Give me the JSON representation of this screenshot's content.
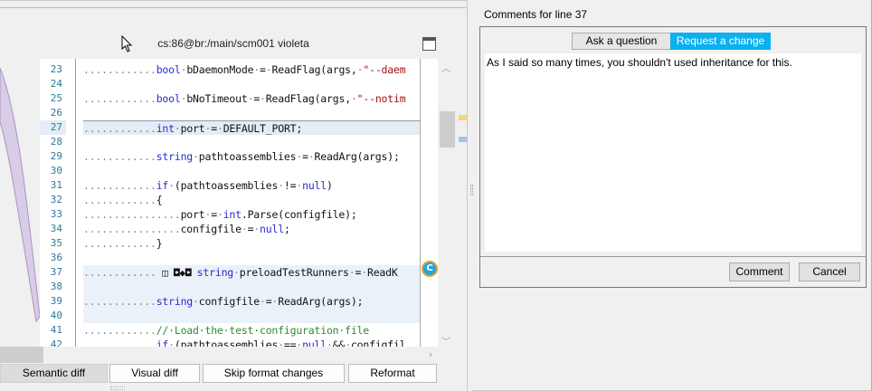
{
  "editor": {
    "file_title": "cs:86@br:/main/scm001 violeta",
    "highlighted_line": 27,
    "comment_line": 37,
    "comment_marker_letter": "C",
    "line_numbers": [
      23,
      24,
      25,
      26,
      27,
      28,
      29,
      30,
      31,
      32,
      33,
      34,
      35,
      36,
      37,
      38,
      39,
      40,
      41,
      42
    ],
    "lines": [
      [
        {
          "t": "............",
          "c": "d"
        },
        {
          "t": "bool",
          "c": "k"
        },
        {
          "t": "·",
          "c": "d"
        },
        {
          "t": "bDaemonMode",
          "c": "p"
        },
        {
          "t": "·",
          "c": "d"
        },
        {
          "t": "=",
          "c": "p"
        },
        {
          "t": "·",
          "c": "d"
        },
        {
          "t": "ReadFlag(args,",
          "c": "p"
        },
        {
          "t": "·",
          "c": "d"
        },
        {
          "t": "\"--daem",
          "c": "s"
        }
      ],
      [],
      [
        {
          "t": "............",
          "c": "d"
        },
        {
          "t": "bool",
          "c": "k"
        },
        {
          "t": "·",
          "c": "d"
        },
        {
          "t": "bNoTimeout",
          "c": "p"
        },
        {
          "t": "·",
          "c": "d"
        },
        {
          "t": "=",
          "c": "p"
        },
        {
          "t": "·",
          "c": "d"
        },
        {
          "t": "ReadFlag(args,",
          "c": "p"
        },
        {
          "t": "·",
          "c": "d"
        },
        {
          "t": "\"--notim",
          "c": "s"
        }
      ],
      [],
      [
        {
          "t": "............",
          "c": "d"
        },
        {
          "t": "int",
          "c": "k"
        },
        {
          "t": "·",
          "c": "d"
        },
        {
          "t": "port",
          "c": "p"
        },
        {
          "t": "·",
          "c": "d"
        },
        {
          "t": "=",
          "c": "p"
        },
        {
          "t": "·",
          "c": "d"
        },
        {
          "t": "DEFAULT_PORT;",
          "c": "p"
        }
      ],
      [],
      [
        {
          "t": "............",
          "c": "d"
        },
        {
          "t": "string",
          "c": "k"
        },
        {
          "t": "·",
          "c": "d"
        },
        {
          "t": "pathtoassemblies",
          "c": "p"
        },
        {
          "t": "·",
          "c": "d"
        },
        {
          "t": "=",
          "c": "p"
        },
        {
          "t": "·",
          "c": "d"
        },
        {
          "t": "ReadArg(args);",
          "c": "p"
        }
      ],
      [],
      [
        {
          "t": "............",
          "c": "d"
        },
        {
          "t": "if",
          "c": "k"
        },
        {
          "t": "·",
          "c": "d"
        },
        {
          "t": "(pathtoassemblies",
          "c": "p"
        },
        {
          "t": "·",
          "c": "d"
        },
        {
          "t": "!=",
          "c": "p"
        },
        {
          "t": "·",
          "c": "d"
        },
        {
          "t": "null",
          "c": "k"
        },
        {
          "t": ")",
          "c": "p"
        }
      ],
      [
        {
          "t": "............",
          "c": "d"
        },
        {
          "t": "{",
          "c": "p"
        }
      ],
      [
        {
          "t": "................",
          "c": "d"
        },
        {
          "t": "port",
          "c": "p"
        },
        {
          "t": "·",
          "c": "d"
        },
        {
          "t": "=",
          "c": "p"
        },
        {
          "t": "·",
          "c": "d"
        },
        {
          "t": "int",
          "c": "k"
        },
        {
          "t": ".Parse(configfile);",
          "c": "p"
        }
      ],
      [
        {
          "t": "................",
          "c": "d"
        },
        {
          "t": "configfile",
          "c": "p"
        },
        {
          "t": "·",
          "c": "d"
        },
        {
          "t": "=",
          "c": "p"
        },
        {
          "t": "·",
          "c": "d"
        },
        {
          "t": "null",
          "c": "k"
        },
        {
          "t": ";",
          "c": "p"
        }
      ],
      [
        {
          "t": "............",
          "c": "d"
        },
        {
          "t": "}",
          "c": "p"
        }
      ],
      [],
      [
        {
          "t": "............",
          "c": "d"
        },
        {
          "t": " ◫ ",
          "c": "ico"
        },
        {
          "t": "◘◆◘ ",
          "c": "ico"
        },
        {
          "t": "string",
          "c": "k"
        },
        {
          "t": "·",
          "c": "d"
        },
        {
          "t": "preloadTestRunners",
          "c": "p"
        },
        {
          "t": "·",
          "c": "d"
        },
        {
          "t": "=",
          "c": "p"
        },
        {
          "t": "·",
          "c": "d"
        },
        {
          "t": "ReadK",
          "c": "p"
        }
      ],
      [],
      [
        {
          "t": "............",
          "c": "d"
        },
        {
          "t": "string",
          "c": "k"
        },
        {
          "t": "·",
          "c": "d"
        },
        {
          "t": "configfile",
          "c": "p"
        },
        {
          "t": "·",
          "c": "d"
        },
        {
          "t": "=",
          "c": "p"
        },
        {
          "t": "·",
          "c": "d"
        },
        {
          "t": "ReadArg(args);",
          "c": "p"
        }
      ],
      [],
      [
        {
          "t": "............",
          "c": "d"
        },
        {
          "t": "//·Load·the·test·configuration·file",
          "c": "c"
        }
      ],
      [
        {
          "t": "............",
          "c": "d"
        },
        {
          "t": "if",
          "c": "k"
        },
        {
          "t": "·",
          "c": "d"
        },
        {
          "t": "(pathtoassemblies",
          "c": "p"
        },
        {
          "t": "·",
          "c": "d"
        },
        {
          "t": "==",
          "c": "p"
        },
        {
          "t": "·",
          "c": "d"
        },
        {
          "t": "null",
          "c": "k"
        },
        {
          "t": "·",
          "c": "d"
        },
        {
          "t": "&&",
          "c": "p"
        },
        {
          "t": "·",
          "c": "d"
        },
        {
          "t": "configfil",
          "c": "p"
        }
      ]
    ]
  },
  "diff_buttons": [
    {
      "label": "Semantic diff",
      "pressed": true
    },
    {
      "label": "Visual diff",
      "pressed": false
    },
    {
      "label": "Skip format changes",
      "pressed": false
    },
    {
      "label": "Reformat",
      "pressed": false
    }
  ],
  "comments": {
    "title": "Comments for line 37",
    "tabs": [
      {
        "label": "Ask a question",
        "active": false
      },
      {
        "label": "Request a change",
        "active": true
      }
    ],
    "text": "As I said so many times, you shouldn't used inheritance for this.",
    "comment_button": "Comment",
    "cancel_button": "Cancel"
  },
  "colors": {
    "accent": "#0ab0f0",
    "diff_region": "#d9cce6",
    "keyword": "#2b2bd0",
    "string": "#a31515",
    "comment": "#2e8b2e"
  }
}
